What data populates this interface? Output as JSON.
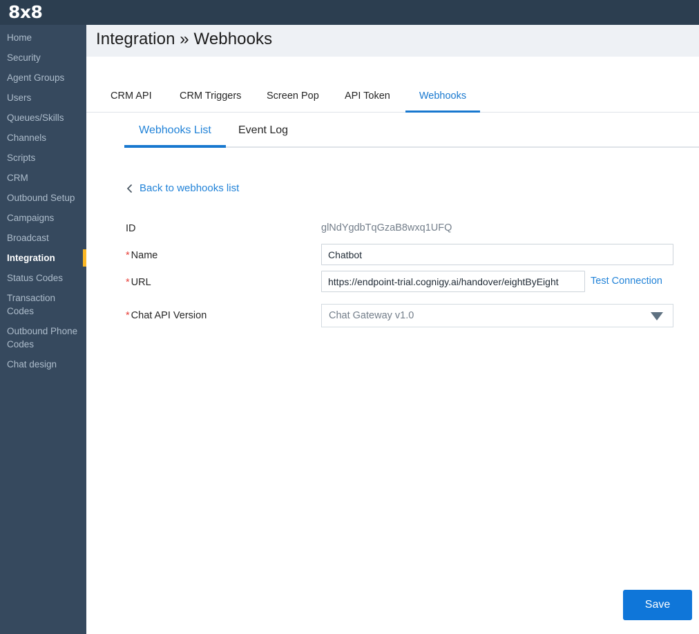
{
  "brand": {
    "logo_text": "8x8"
  },
  "sidebar": {
    "items": [
      {
        "label": "Home",
        "active": false
      },
      {
        "label": "Security",
        "active": false
      },
      {
        "label": "Agent Groups",
        "active": false
      },
      {
        "label": "Users",
        "active": false
      },
      {
        "label": "Queues/Skills",
        "active": false
      },
      {
        "label": "Channels",
        "active": false
      },
      {
        "label": "Scripts",
        "active": false
      },
      {
        "label": "CRM",
        "active": false
      },
      {
        "label": "Outbound Setup",
        "active": false
      },
      {
        "label": "Campaigns",
        "active": false
      },
      {
        "label": "Broadcast",
        "active": false
      },
      {
        "label": "Integration",
        "active": true
      },
      {
        "label": "Status Codes",
        "active": false
      },
      {
        "label": "Transaction Codes",
        "active": false
      },
      {
        "label": "Outbound Phone Codes",
        "active": false
      },
      {
        "label": "Chat design",
        "active": false
      }
    ]
  },
  "header": {
    "title": "Integration » Webhooks"
  },
  "tabs": [
    {
      "label": "CRM API",
      "active": false
    },
    {
      "label": "CRM Triggers",
      "active": false
    },
    {
      "label": "Screen Pop",
      "active": false
    },
    {
      "label": "API Token",
      "active": false
    },
    {
      "label": "Webhooks",
      "active": true
    }
  ],
  "subtabs": [
    {
      "label": "Webhooks List",
      "active": true
    },
    {
      "label": "Event Log",
      "active": false
    }
  ],
  "back_link": {
    "label": "Back to webhooks list",
    "icon": "chevron-left-icon"
  },
  "form": {
    "id": {
      "label": "ID",
      "value": "glNdYgdbTqGzaB8wxq1UFQ",
      "required": false
    },
    "name": {
      "label": "Name",
      "value": "Chatbot",
      "placeholder": "",
      "required": true
    },
    "url": {
      "label": "URL",
      "value": "https://endpoint-trial.cognigy.ai/handover/eightByEight",
      "placeholder": "",
      "required": true
    },
    "test_connection": {
      "label": "Test Connection"
    },
    "chat_api_version": {
      "label": "Chat API Version",
      "value": "Chat Gateway v1.0",
      "required": true,
      "options": [
        "Chat Gateway v1.0"
      ]
    },
    "required_marker": "*"
  },
  "actions": {
    "save_label": "Save"
  },
  "colors": {
    "topbar": "#2c3e50",
    "sidebar": "#36495e",
    "sidebar_active_bar": "#fbb724",
    "header_band": "#eef1f5",
    "accent_blue": "#1878cf",
    "link_blue": "#2283d8",
    "required_red": "#e8403a",
    "save_blue": "#0f76d9"
  }
}
